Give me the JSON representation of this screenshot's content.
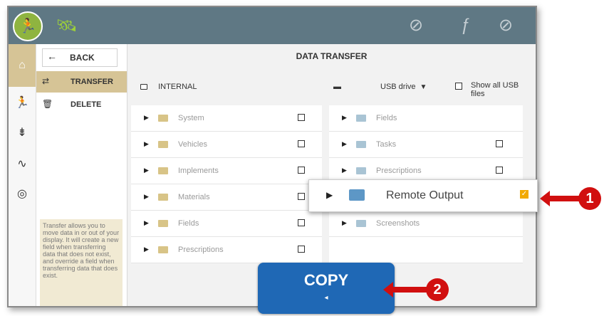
{
  "screen": {
    "title": "DATA TRANSFER"
  },
  "topbar": {
    "logo": "🏃",
    "icons": [
      "satellite-icon",
      "tractor-off-icon",
      "steering-off-icon",
      "no-guidance-icon"
    ]
  },
  "leftnav": {
    "items": [
      "home",
      "run",
      "implement",
      "diagnostics",
      "gps"
    ]
  },
  "submenu": {
    "back_label": "BACK",
    "items": [
      {
        "label": "TRANSFER",
        "icon": "transfer-icon",
        "active": true
      },
      {
        "label": "DELETE",
        "icon": "trash-icon",
        "active": false
      }
    ],
    "help_text": "Transfer allows you to move data in or out of your display. It will create a new field when transferring data that does not exist, and override a field when transferring data that does exist."
  },
  "source": {
    "label": "INTERNAL"
  },
  "destination": {
    "label": "USB drive",
    "show_all_label": "Show all USB files"
  },
  "internal_folders": [
    {
      "name": "System"
    },
    {
      "name": "Vehicles"
    },
    {
      "name": "Implements"
    },
    {
      "name": "Materials"
    },
    {
      "name": "Fields"
    },
    {
      "name": "Prescriptions"
    }
  ],
  "usb_folders": [
    {
      "name": "Fields",
      "checkbox": false
    },
    {
      "name": "Tasks",
      "checkbox": true
    },
    {
      "name": "Prescriptions",
      "checkbox": true
    },
    {
      "name": "",
      "checkbox": false
    },
    {
      "name": "Screenshots",
      "checkbox": false
    },
    {
      "name": "",
      "checkbox": false
    }
  ],
  "popup": {
    "name": "Remote Output",
    "checked": true
  },
  "copy_button": {
    "label": "COPY",
    "sub": "◂"
  },
  "callouts": [
    "1",
    "2"
  ],
  "colors": {
    "topbar": "#5f7884",
    "accent": "#d6c496",
    "copy": "#1f68b5",
    "callout": "#d10f0f",
    "check": "#f2a900"
  }
}
